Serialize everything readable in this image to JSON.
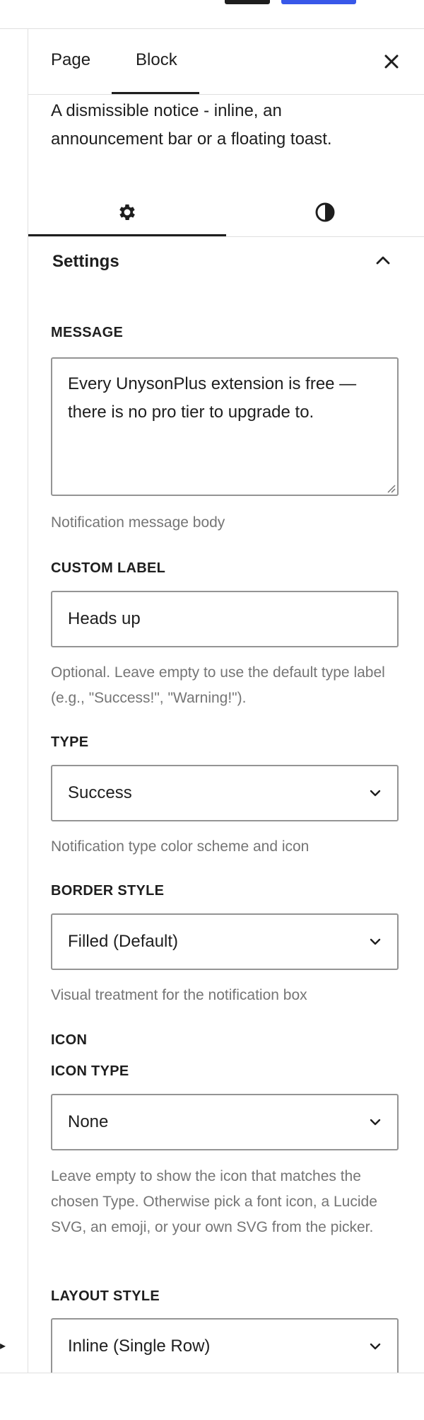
{
  "tabs": {
    "page_label": "Page",
    "block_label": "Block"
  },
  "block_description": "A dismissible notice - inline, an announcement bar or a floating toast.",
  "panel": {
    "title": "Settings"
  },
  "fields": {
    "message": {
      "label": "MESSAGE",
      "value": "Every UnysonPlus extension is free — there is no pro tier to upgrade to.",
      "help": "Notification message body"
    },
    "custom_label": {
      "label": "CUSTOM LABEL",
      "value": "Heads up",
      "help": "Optional. Leave empty to use the default type label (e.g., \"Success!\", \"Warning!\")."
    },
    "type": {
      "label": "TYPE",
      "value": "Success",
      "help": "Notification type color scheme and icon"
    },
    "border_style": {
      "label": "BORDER STYLE",
      "value": "Filled (Default)",
      "help": "Visual treatment for the notification box"
    },
    "icon": {
      "group_label": "ICON",
      "label": "ICON TYPE",
      "value": "None",
      "help": "Leave empty to show the icon that matches the chosen Type. Otherwise pick a font icon, a Lucide SVG, an emoji, or your own SVG from the picker."
    },
    "layout_style": {
      "label": "LAYOUT STYLE",
      "value": "Inline (Single Row)"
    }
  },
  "icons": {
    "close": "close-icon",
    "settings_tab": "gear-icon",
    "styles_tab": "contrast-icon",
    "collapse": "chevron-up-icon",
    "select": "chevron-down-icon"
  },
  "colors": {
    "text": "#1e1e1e",
    "help_text": "#757575",
    "border": "#949494",
    "divider": "#e0e0e0",
    "accent": "#3858e9"
  }
}
